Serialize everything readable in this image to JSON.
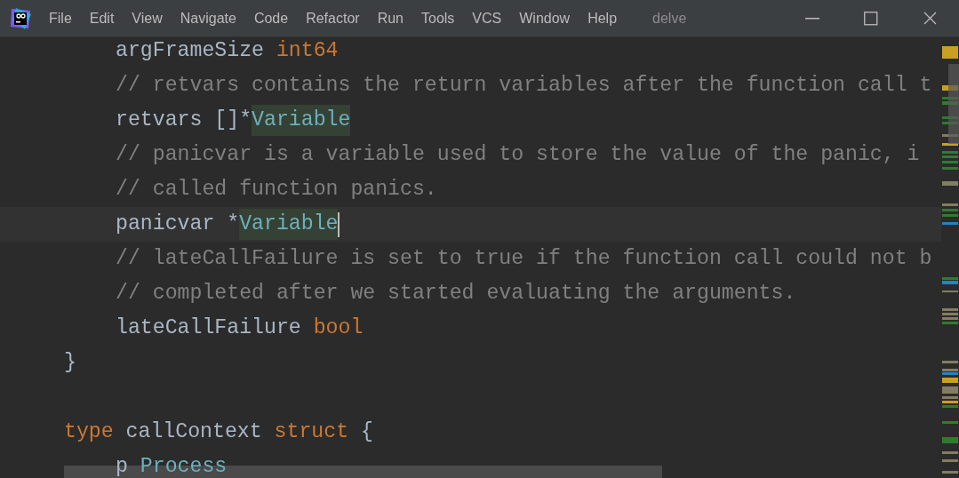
{
  "window": {
    "title": "delve"
  },
  "menu": [
    "File",
    "Edit",
    "View",
    "Navigate",
    "Code",
    "Refactor",
    "Run",
    "Tools",
    "VCS",
    "Window",
    "Help"
  ],
  "editor": {
    "lines": [
      {
        "indented": true,
        "current": false,
        "tokens": [
          {
            "kind": "plain",
            "text": "argFrameSize "
          },
          {
            "kind": "keyword",
            "text": "int64"
          }
        ]
      },
      {
        "indented": true,
        "current": false,
        "tokens": [
          {
            "kind": "comment",
            "text": "// retvars contains the return variables after the function call t"
          }
        ]
      },
      {
        "indented": true,
        "current": false,
        "tokens": [
          {
            "kind": "plain",
            "text": "retvars []*"
          },
          {
            "kind": "type",
            "text": "Variable",
            "highlighted": true
          }
        ]
      },
      {
        "indented": true,
        "current": false,
        "tokens": [
          {
            "kind": "comment",
            "text": "// panicvar is a variable used to store the value of the panic, i"
          }
        ]
      },
      {
        "indented": true,
        "current": false,
        "tokens": [
          {
            "kind": "comment",
            "text": "// called function panics."
          }
        ]
      },
      {
        "indented": true,
        "current": true,
        "tokens": [
          {
            "kind": "plain",
            "text": "panicvar *"
          },
          {
            "kind": "type",
            "text": "Variable",
            "highlighted": true
          }
        ]
      },
      {
        "indented": true,
        "current": false,
        "tokens": [
          {
            "kind": "comment",
            "text": "// lateCallFailure is set to true if the function call could not b"
          }
        ]
      },
      {
        "indented": true,
        "current": false,
        "tokens": [
          {
            "kind": "comment",
            "text": "// completed after we started evaluating the arguments."
          }
        ]
      },
      {
        "indented": true,
        "current": false,
        "tokens": [
          {
            "kind": "plain",
            "text": "lateCallFailure "
          },
          {
            "kind": "keyword",
            "text": "bool"
          }
        ]
      },
      {
        "indented": false,
        "current": false,
        "tokens": [
          {
            "kind": "plain",
            "text": "}"
          }
        ]
      },
      {
        "current": false
      },
      {
        "indented": false,
        "current": false,
        "tokens": [
          {
            "kind": "keyword",
            "text": "type "
          },
          {
            "kind": "plain",
            "text": "callContext "
          },
          {
            "kind": "keyword",
            "text": "struct "
          },
          {
            "kind": "plain",
            "text": "{"
          }
        ]
      },
      {
        "indented": true,
        "current": false,
        "tokens": [
          {
            "kind": "plain",
            "text": "p "
          },
          {
            "kind": "type",
            "text": "Process"
          }
        ]
      }
    ]
  }
}
